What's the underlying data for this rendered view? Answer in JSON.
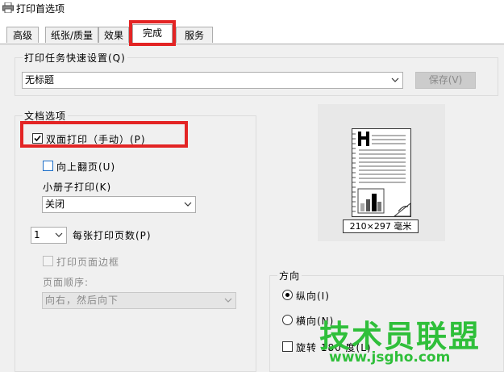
{
  "window": {
    "title": "打印首选项"
  },
  "tabs": [
    {
      "label": "高级",
      "active": false
    },
    {
      "label": "纸张/质量",
      "active": false
    },
    {
      "label": "效果",
      "active": false
    },
    {
      "label": "完成",
      "active": true
    },
    {
      "label": "服务",
      "active": false
    }
  ],
  "quick_settings": {
    "legend": "打印任务快速设置(Q)",
    "selected": "无标题",
    "save_label": "保存(V)"
  },
  "document_options": {
    "legend": "文档选项",
    "duplex_label": "双面打印（手动）(P)",
    "duplex_checked": true,
    "flip_up_label": "向上翻页(U)",
    "flip_up_checked": false,
    "booklet_label": "小册子打印(K)",
    "booklet_value": "关闭",
    "pages_per_sheet_value": "1",
    "pages_per_sheet_label": "每张打印页数(P)",
    "page_border_label": "打印页面边框",
    "page_border_checked": false,
    "page_order_label": "页面顺序:",
    "page_order_value": "向右，然后向下"
  },
  "preview": {
    "paper_size": "210×297 毫米"
  },
  "orientation": {
    "legend": "方向",
    "portrait_label": "纵向(I)",
    "landscape_label": "横向(N)",
    "rotate_label": "旋转 180 度(L)",
    "selected": "portrait"
  },
  "watermark": {
    "text": "技术员联盟",
    "url": "www.jsgho.com"
  },
  "colors": {
    "highlight": "#e32424",
    "watermark": "#2fbf3a",
    "checkbox_accent": "#1e6fc9"
  }
}
